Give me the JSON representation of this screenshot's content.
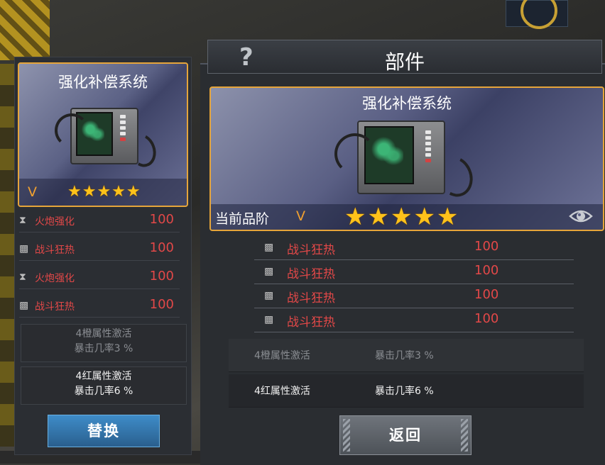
{
  "left_panel": {
    "part_name": "强化补偿系统",
    "rank": "V",
    "stars": "★★★★★",
    "attributes": [
      {
        "icon": "cannon-icon",
        "name": "火炮强化",
        "value": "100"
      },
      {
        "icon": "frenzy-icon",
        "name": "战斗狂热",
        "value": "100"
      },
      {
        "icon": "cannon-icon",
        "name": "火炮强化",
        "value": "100"
      },
      {
        "icon": "frenzy-icon",
        "name": "战斗狂热",
        "value": "100"
      }
    ],
    "bonuses": [
      {
        "title": "4橙属性激活",
        "effect": "暴击几率3 %",
        "active": false
      },
      {
        "title": "4红属性激活",
        "effect": "暴击几率6 %",
        "active": true
      }
    ],
    "replace_button": "替换"
  },
  "right_panel": {
    "header_title": "部件",
    "help_icon": "?",
    "part_name": "强化补偿系统",
    "current_rank_label": "当前品阶",
    "rank": "V",
    "star_count": 5,
    "attributes": [
      {
        "icon": "frenzy-icon",
        "name": "战斗狂热",
        "value": "100"
      },
      {
        "icon": "frenzy-icon",
        "name": "战斗狂热",
        "value": "100"
      },
      {
        "icon": "frenzy-icon",
        "name": "战斗狂热",
        "value": "100"
      },
      {
        "icon": "frenzy-icon",
        "name": "战斗狂热",
        "value": "100"
      }
    ],
    "bonuses": [
      {
        "title": "4橙属性激活",
        "effect": "暴击几率3 %",
        "active": false
      },
      {
        "title": "4红属性激活",
        "effect": "暴击几率6 %",
        "active": true
      }
    ],
    "back_button": "返回"
  },
  "colors": {
    "rank_gold": "#e6a53a",
    "attr_red": "#e24848",
    "star": "#ffc21a",
    "replace_blue": "#3e8cc8"
  }
}
